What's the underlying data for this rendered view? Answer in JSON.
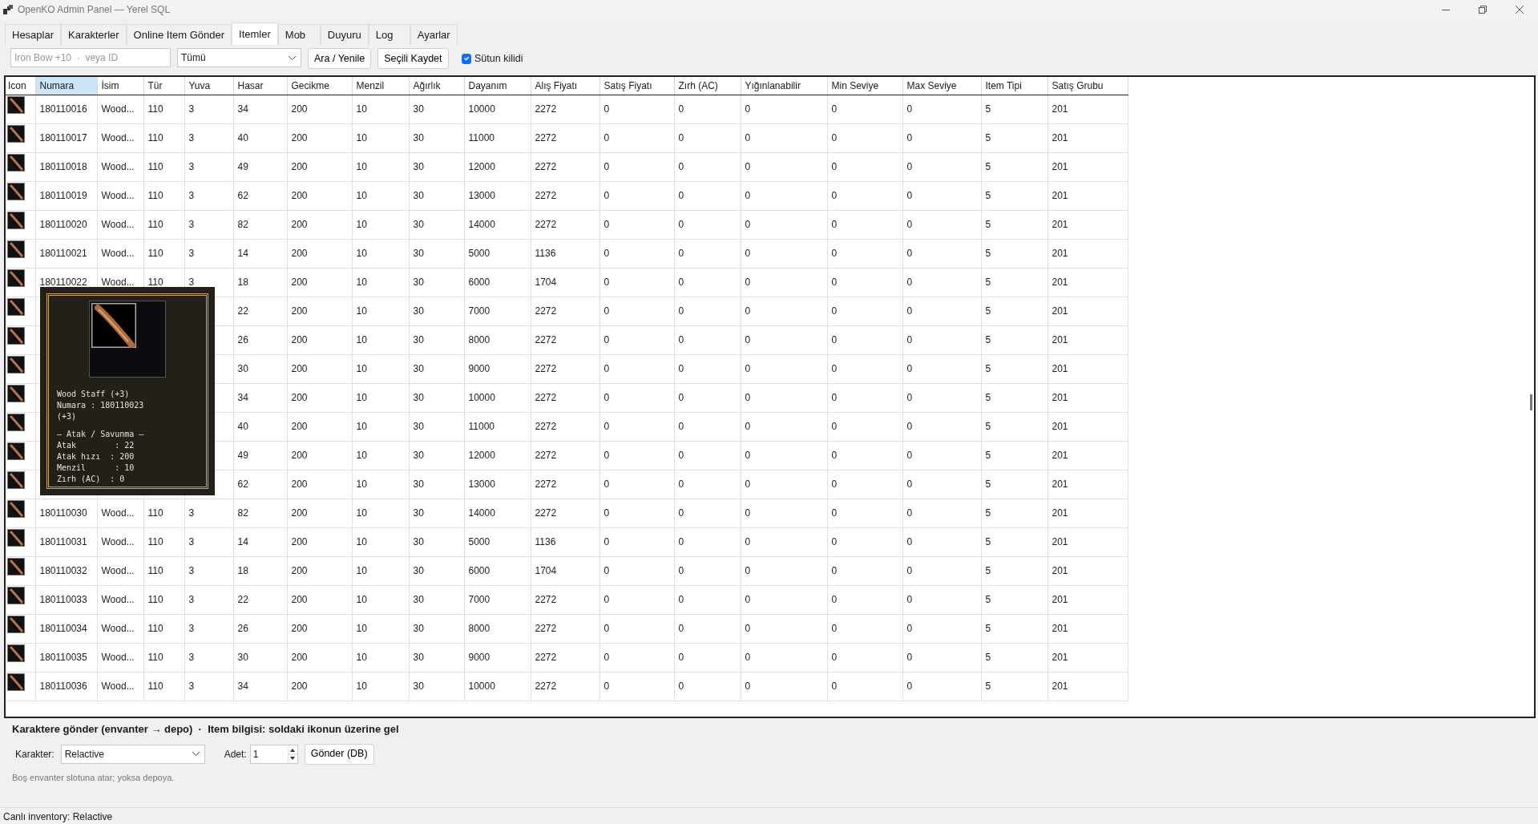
{
  "window": {
    "title": "OpenKO Admin Panel — Yerel SQL"
  },
  "tabs": [
    {
      "label": "Hesaplar",
      "selected": false
    },
    {
      "label": "Karakterler",
      "selected": false
    },
    {
      "label": "Online Item Gönder",
      "selected": false
    },
    {
      "label": "Itemler",
      "selected": true
    },
    {
      "label": "Mob",
      "selected": false
    },
    {
      "label": "Duyuru",
      "selected": false
    },
    {
      "label": "Log",
      "selected": false
    },
    {
      "label": "Ayarlar",
      "selected": false
    }
  ],
  "toolbar": {
    "search": {
      "placeholder": "Iron Bow +10  ·  veya ID"
    },
    "filter": {
      "value": "Tümü"
    },
    "buttons": [
      "Ara / Yenile",
      "Seçili Kaydet"
    ],
    "column_lock": {
      "label": "Sütun kilidi",
      "checked": true
    }
  },
  "table": {
    "icon_column": {
      "label": "Icon"
    },
    "columns": [
      {
        "label": "Numara",
        "selected": true
      },
      {
        "label": "İsim",
        "selected": false
      },
      {
        "label": "Tür",
        "selected": false
      },
      {
        "label": "Yuva",
        "selected": false
      },
      {
        "label": "Hasar",
        "selected": false
      },
      {
        "label": "Gecikme",
        "selected": false
      },
      {
        "label": "Menzil",
        "selected": false
      },
      {
        "label": "Ağırlık",
        "selected": false
      },
      {
        "label": "Dayanım",
        "selected": false
      },
      {
        "label": "Alış Fiyatı",
        "selected": false
      },
      {
        "label": "Satış Fiyatı",
        "selected": false
      },
      {
        "label": "Zırh (AC)",
        "selected": false
      },
      {
        "label": "Yığınlanabilir",
        "selected": false
      },
      {
        "label": "Min Seviye",
        "selected": false
      },
      {
        "label": "Max Seviye",
        "selected": false
      },
      {
        "label": "Item Tipi",
        "selected": false
      },
      {
        "label": "Satış Grubu",
        "selected": false
      }
    ],
    "rows": [
      {
        "cells": [
          "180110016",
          "Wood...",
          "110",
          "3",
          "34",
          "200",
          "10",
          "30",
          "10000",
          "2272",
          "0",
          "0",
          "0",
          "0",
          "0",
          "5",
          "201"
        ]
      },
      {
        "cells": [
          "180110017",
          "Wood...",
          "110",
          "3",
          "40",
          "200",
          "10",
          "30",
          "11000",
          "2272",
          "0",
          "0",
          "0",
          "0",
          "0",
          "5",
          "201"
        ]
      },
      {
        "cells": [
          "180110018",
          "Wood...",
          "110",
          "3",
          "49",
          "200",
          "10",
          "30",
          "12000",
          "2272",
          "0",
          "0",
          "0",
          "0",
          "0",
          "5",
          "201"
        ]
      },
      {
        "cells": [
          "180110019",
          "Wood...",
          "110",
          "3",
          "62",
          "200",
          "10",
          "30",
          "13000",
          "2272",
          "0",
          "0",
          "0",
          "0",
          "0",
          "5",
          "201"
        ]
      },
      {
        "cells": [
          "180110020",
          "Wood...",
          "110",
          "3",
          "82",
          "200",
          "10",
          "30",
          "14000",
          "2272",
          "0",
          "0",
          "0",
          "0",
          "0",
          "5",
          "201"
        ]
      },
      {
        "cells": [
          "180110021",
          "Wood...",
          "110",
          "3",
          "14",
          "200",
          "10",
          "30",
          "5000",
          "1136",
          "0",
          "0",
          "0",
          "0",
          "0",
          "5",
          "201"
        ]
      },
      {
        "cells": [
          "180110022",
          "Wood...",
          "110",
          "3",
          "18",
          "200",
          "10",
          "30",
          "6000",
          "1704",
          "0",
          "0",
          "0",
          "0",
          "0",
          "5",
          "201"
        ]
      },
      {
        "cells": [
          null,
          null,
          null,
          null,
          "22",
          "200",
          "10",
          "30",
          "7000",
          "2272",
          "0",
          "0",
          "0",
          "0",
          "0",
          "5",
          "201"
        ]
      },
      {
        "cells": [
          null,
          null,
          null,
          null,
          "26",
          "200",
          "10",
          "30",
          "8000",
          "2272",
          "0",
          "0",
          "0",
          "0",
          "0",
          "5",
          "201"
        ]
      },
      {
        "cells": [
          null,
          null,
          null,
          null,
          "30",
          "200",
          "10",
          "30",
          "9000",
          "2272",
          "0",
          "0",
          "0",
          "0",
          "0",
          "5",
          "201"
        ]
      },
      {
        "cells": [
          null,
          null,
          null,
          null,
          "34",
          "200",
          "10",
          "30",
          "10000",
          "2272",
          "0",
          "0",
          "0",
          "0",
          "0",
          "5",
          "201"
        ]
      },
      {
        "cells": [
          null,
          null,
          null,
          null,
          "40",
          "200",
          "10",
          "30",
          "11000",
          "2272",
          "0",
          "0",
          "0",
          "0",
          "0",
          "5",
          "201"
        ]
      },
      {
        "cells": [
          null,
          null,
          null,
          null,
          "49",
          "200",
          "10",
          "30",
          "12000",
          "2272",
          "0",
          "0",
          "0",
          "0",
          "0",
          "5",
          "201"
        ]
      },
      {
        "cells": [
          null,
          null,
          null,
          null,
          "62",
          "200",
          "10",
          "30",
          "13000",
          "2272",
          "0",
          "0",
          "0",
          "0",
          "0",
          "5",
          "201"
        ]
      },
      {
        "cells": [
          "180110030",
          "Wood...",
          "110",
          "3",
          "82",
          "200",
          "10",
          "30",
          "14000",
          "2272",
          "0",
          "0",
          "0",
          "0",
          "0",
          "5",
          "201"
        ]
      },
      {
        "cells": [
          "180110031",
          "Wood...",
          "110",
          "3",
          "14",
          "200",
          "10",
          "30",
          "5000",
          "1136",
          "0",
          "0",
          "0",
          "0",
          "0",
          "5",
          "201"
        ]
      },
      {
        "cells": [
          "180110032",
          "Wood...",
          "110",
          "3",
          "18",
          "200",
          "10",
          "30",
          "6000",
          "1704",
          "0",
          "0",
          "0",
          "0",
          "0",
          "5",
          "201"
        ]
      },
      {
        "cells": [
          "180110033",
          "Wood...",
          "110",
          "3",
          "22",
          "200",
          "10",
          "30",
          "7000",
          "2272",
          "0",
          "0",
          "0",
          "0",
          "0",
          "5",
          "201"
        ]
      },
      {
        "cells": [
          "180110034",
          "Wood...",
          "110",
          "3",
          "26",
          "200",
          "10",
          "30",
          "8000",
          "2272",
          "0",
          "0",
          "0",
          "0",
          "0",
          "5",
          "201"
        ]
      },
      {
        "cells": [
          "180110035",
          "Wood...",
          "110",
          "3",
          "30",
          "200",
          "10",
          "30",
          "9000",
          "2272",
          "0",
          "0",
          "0",
          "0",
          "0",
          "5",
          "201"
        ]
      },
      {
        "cells": [
          "180110036",
          "Wood...",
          "110",
          "3",
          "34",
          "200",
          "10",
          "30",
          "10000",
          "2272",
          "0",
          "0",
          "0",
          "0",
          "0",
          "5",
          "201"
        ]
      }
    ]
  },
  "tooltip": {
    "header_lines": [
      "Wood Staff (+3)",
      "Numara : 180110023",
      "(+3)"
    ],
    "stat_lines": [
      "— Atak / Savunma —",
      "Atak        : 22",
      "Atak hızı  : 200",
      "Menzil      : 10",
      "Zırh (AC)  : 0"
    ]
  },
  "send_panel": {
    "title": "Karaktere gönder (envanter → depo)  ·  Item bilgisi: soldaki ikonun üzerine gel",
    "character_label": "Karakter:",
    "character": "Relactive",
    "amount_label": "Adet:",
    "amount": "1",
    "button": "Gönder (DB)",
    "hint": "Boş envanter slotuna atar; yoksa depoya."
  },
  "status_bar": "Canlı inventory: Relactive"
}
